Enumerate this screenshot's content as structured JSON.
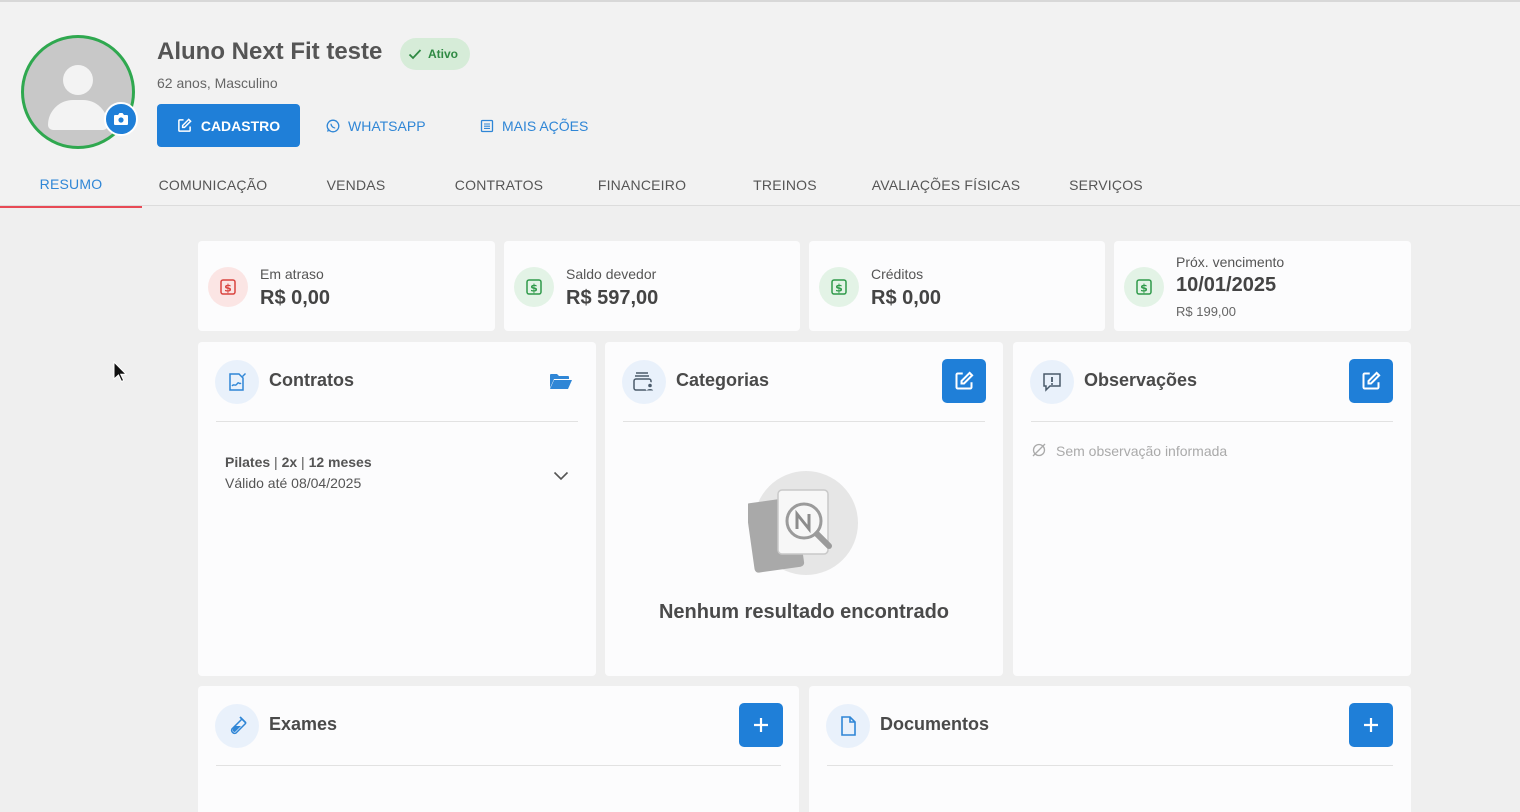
{
  "profile": {
    "name": "Aluno Next Fit teste",
    "status": "Ativo",
    "subtitle": "62 anos, Masculino"
  },
  "actions": {
    "cadastro": "CADASTRO",
    "whatsapp": "WHATSAPP",
    "mais_acoes": "MAIS AÇÕES"
  },
  "tabs": [
    {
      "label": "RESUMO",
      "active": true
    },
    {
      "label": "COMUNICAÇÃO"
    },
    {
      "label": "VENDAS"
    },
    {
      "label": "CONTRATOS"
    },
    {
      "label": "FINANCEIRO"
    },
    {
      "label": "TREINOS"
    },
    {
      "label": "AVALIAÇÕES FÍSICAS"
    },
    {
      "label": "SERVIÇOS"
    }
  ],
  "stats": [
    {
      "label": "Em atraso",
      "value": "R$ 0,00",
      "color": "#d9443f"
    },
    {
      "label": "Saldo devedor",
      "value": "R$ 597,00",
      "color": "#2f9a4a"
    },
    {
      "label": "Créditos",
      "value": "R$ 0,00",
      "color": "#2f9a4a"
    },
    {
      "label": "Próx. vencimento",
      "value": "10/01/2025",
      "sub": "R$ 199,00",
      "color": "#2f9a4a"
    }
  ],
  "contratos": {
    "title": "Contratos",
    "item_name_parts": [
      "Pilates",
      "2x",
      "12 meses"
    ],
    "item_valid": "Válido até 08/04/2025"
  },
  "categorias": {
    "title": "Categorias",
    "empty": "Nenhum resultado encontrado"
  },
  "observacoes": {
    "title": "Observações",
    "empty": "Sem observação informada"
  },
  "exames": {
    "title": "Exames"
  },
  "documentos": {
    "title": "Documentos"
  },
  "colors": {
    "accent": "#1f7fd8",
    "active_tab_underline": "#e84a55",
    "status_green": "#2fa84f"
  }
}
